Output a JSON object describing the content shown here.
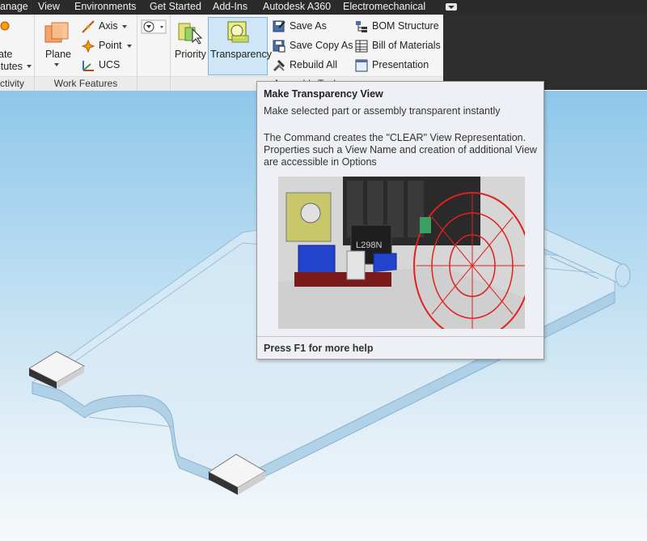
{
  "menu": {
    "items": [
      "anage",
      "View",
      "Environments",
      "Get Started",
      "Add-Ins",
      "Autodesk A360",
      "Electromechanical"
    ]
  },
  "ribbon": {
    "create_substitutes": "ate\nitutes",
    "plane_label": "Plane",
    "axis_label": "Axis",
    "point_label": "Point",
    "ucs_label": "UCS",
    "priority_label": "Priority",
    "transparency_label": "Transparency",
    "save_as_label": "Save As",
    "save_copy_as_label": "Save Copy As",
    "rebuild_all_label": "Rebuild All",
    "bom_structure_label": "BOM Structure",
    "bill_of_materials_label": "Bill of Materials",
    "presentation_label": "Presentation",
    "panel_productivity": "ctivity",
    "panel_work_features": "Work Features",
    "panel_assembly_tools": "Assembly Tools"
  },
  "tooltip": {
    "title": "Make Transparency View",
    "subtitle": "Make selected part or assembly transparent instantly",
    "description": "The Command creates the \"CLEAR\" View Representation. Properties such a View Name and creation of additional View are accessible in Options",
    "chip_label": "L298N",
    "footer": "Press F1 for more help"
  },
  "colors": {
    "menubar_bg": "#2b2b2b",
    "ribbon_bg": "#f5f5f5",
    "accent_selected": "#cfe6f7",
    "viewport_top": "#8ec7ea"
  }
}
